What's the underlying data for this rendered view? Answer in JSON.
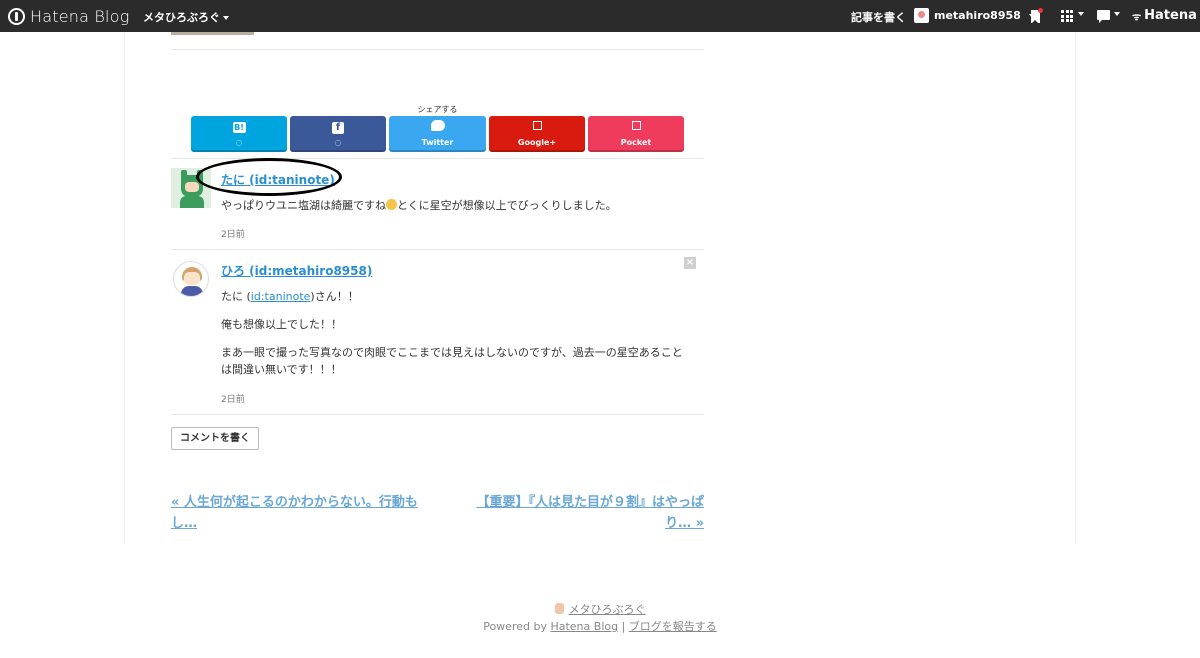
{
  "topbar": {
    "logo_text": "Hatena Blog",
    "blog_name": "メタひろぶろぐ",
    "write_label": "記事を書く",
    "username": "metahiro8958",
    "hatena_label": "Hatena"
  },
  "share": {
    "title": "シェアする",
    "buttons": [
      {
        "icon_text": "B!",
        "label": "",
        "color": "#00a4de"
      },
      {
        "icon_text": "f",
        "label": "",
        "color": "#3b5998"
      },
      {
        "icon_text": "",
        "label": "Twitter",
        "color": "#39a8f0"
      },
      {
        "icon_text": "",
        "label": "Google+",
        "color": "#d81b0e"
      },
      {
        "icon_text": "",
        "label": "Pocket",
        "color": "#ef3c5d"
      }
    ]
  },
  "comments": [
    {
      "author": "たに (id:taninote)",
      "text": "やっぱりウユニ塩湖は綺麗ですね",
      "text_after_emoji": "とくに星空が想像以上でびっくりしました。",
      "time": "2日前"
    },
    {
      "author": "ひろ (id:metahiro8958)",
      "line1_prefix": "たに (",
      "line1_link": "id:taninote",
      "line1_suffix": ")さん！！",
      "line2": "俺も想像以上でした！！",
      "line3": "まあ一眼で撮った写真なので肉眼でここまでは見えはしないのですが、過去一の星空あること",
      "line4": "は間違い無いです！！！",
      "time": "2日前",
      "delete_icon": "×"
    }
  ],
  "comment_button": "コメントを書く",
  "pager": {
    "prev": "« 人生何が起こるのかわからない。行動もし…",
    "next": "【重要】『人は見た目が９割』はやっぱり… »"
  },
  "footer": {
    "blog_name": "メタひろぶろぐ",
    "powered_prefix": "Powered by ",
    "powered_link": "Hatena Blog",
    "separator": " | ",
    "report_link": "ブログを報告する"
  }
}
